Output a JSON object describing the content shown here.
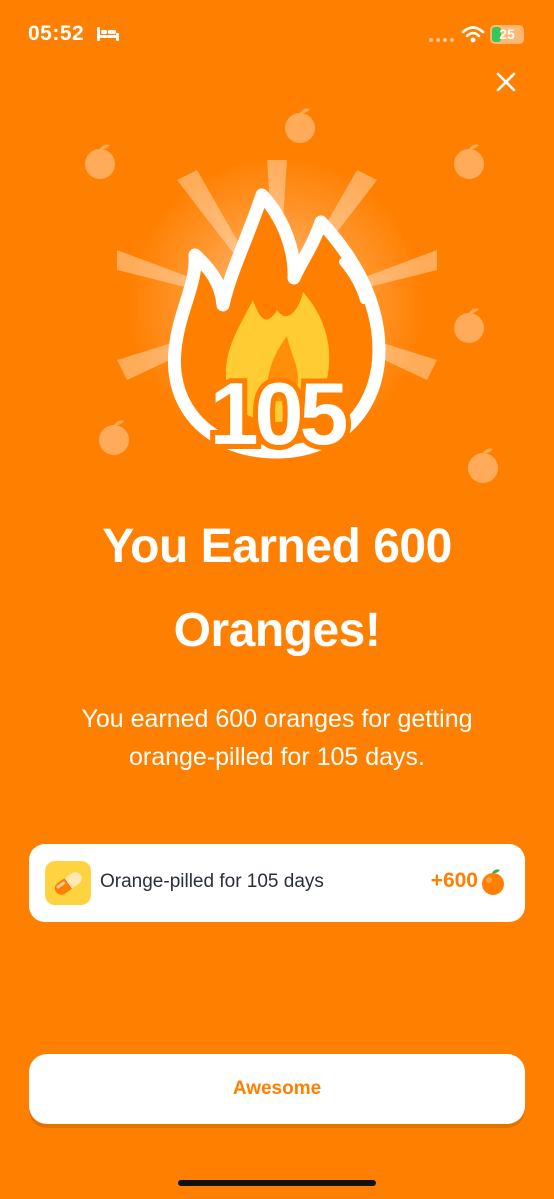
{
  "status_bar": {
    "time": "05:52",
    "battery": "25",
    "icons": [
      "bed-icon",
      "signal-icon",
      "wifi-icon",
      "battery-charging-icon"
    ]
  },
  "close_icon": "close-icon",
  "hero": {
    "streak_count": "105",
    "icon": "flame-icon"
  },
  "headline": "You Earned 600 Oranges!",
  "subtext": "You earned 600 oranges for getting orange-pilled for 105 days.",
  "reward": {
    "icon": "pill-icon",
    "label": "Orange-pilled for 105 days",
    "amount": "+600",
    "amount_icon": "orange-icon"
  },
  "primary_button": {
    "label": "Awesome"
  },
  "colors": {
    "background": "#FF7F00",
    "card": "#FFFFFF",
    "accent": "#FF7F00",
    "flame_inner": "#FFCC33"
  }
}
